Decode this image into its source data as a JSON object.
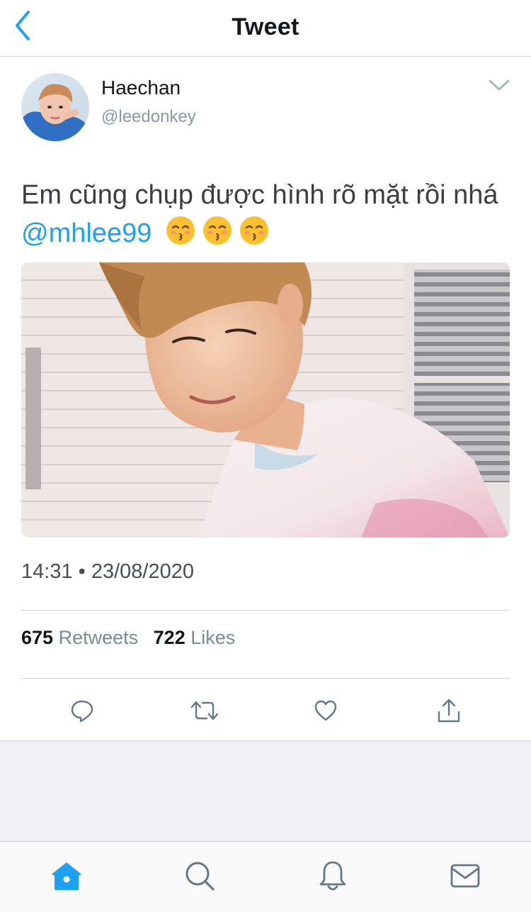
{
  "header": {
    "title": "Tweet",
    "back_icon": "chevron-left-icon"
  },
  "author": {
    "name": "Haechan",
    "handle": "@leedonkey",
    "menu_icon": "chevron-down-icon"
  },
  "tweet": {
    "text_main": "Em cũng chụp được hình rõ mặt rồi nhá ",
    "mention": "@mhlee99",
    "emoji_count": 3,
    "emoji_name": "kissing-face-with-smiling-eyes"
  },
  "meta": {
    "time": "14:31",
    "separator": "•",
    "date": "23/08/2020"
  },
  "stats": {
    "retweets_count": "675",
    "retweets_label": "Retweets",
    "likes_count": "722",
    "likes_label": "Likes"
  },
  "actions": [
    "reply-icon",
    "retweet-icon",
    "like-icon",
    "share-icon"
  ],
  "tabbar": [
    "home-icon",
    "search-icon",
    "notifications-icon",
    "messages-icon"
  ],
  "colors": {
    "accent": "#1da1f2",
    "text_primary": "#14171a",
    "text_secondary": "#8899a6",
    "divider": "#d3d6d9",
    "gray_background": "#efeff4"
  }
}
